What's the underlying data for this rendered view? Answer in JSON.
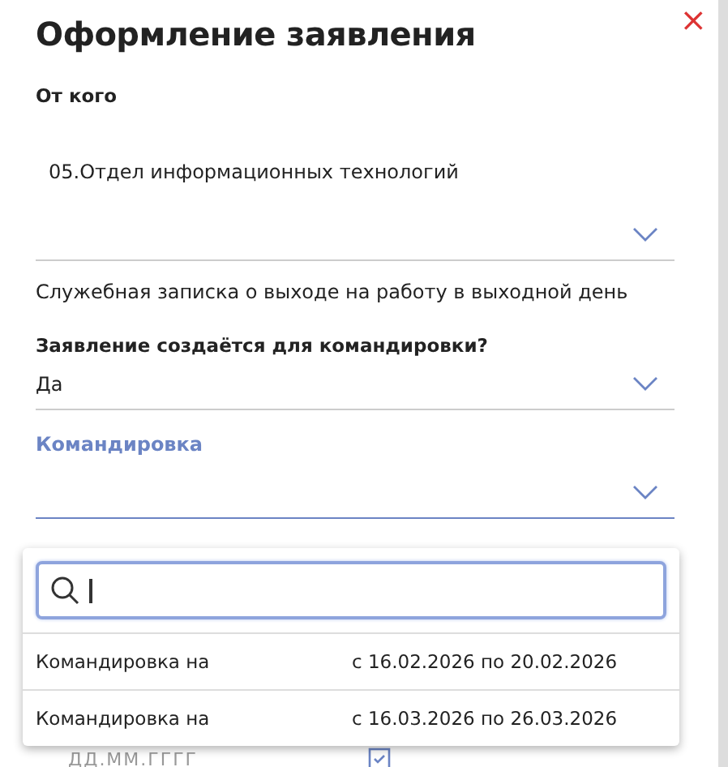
{
  "dialog": {
    "title": "Оформление заявления",
    "close": "×"
  },
  "from": {
    "label": "От кого",
    "department": "05.Отдел информационных технологий"
  },
  "memo": "Служебная записка о выходе на работу в выходной день",
  "question": {
    "label": "Заявление создаётся для командировки?",
    "value": "Да"
  },
  "trip": {
    "label": "Командировка",
    "open": true
  },
  "dropdown": {
    "options": [
      {
        "prefix": "Командировка на",
        "dates": "с 16.02.2026 по 20.02.2026",
        "selected": false
      },
      {
        "prefix": "Командировка на",
        "dates": "с 16.03.2026 по 26.03.2026",
        "selected": false
      }
    ]
  },
  "date_field": {
    "placeholder": "ДД.ММ.ГГГГ"
  }
}
